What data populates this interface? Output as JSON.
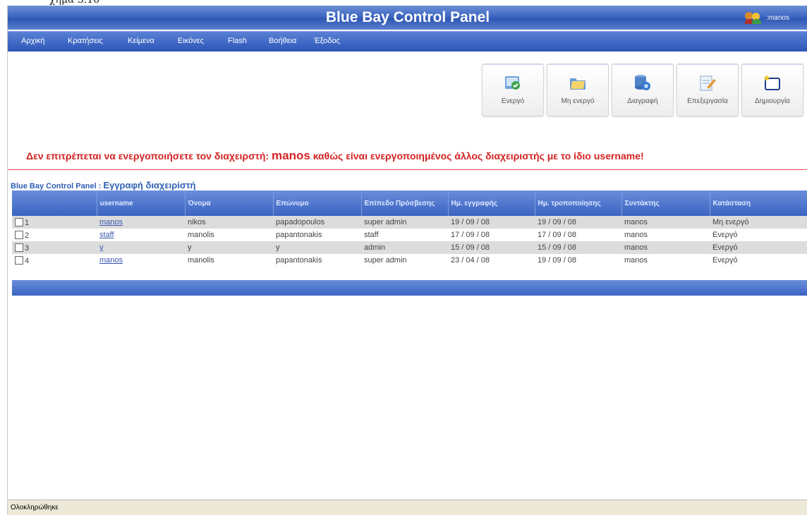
{
  "fragment_text": "χήμα 3.16",
  "header": {
    "title": "Blue Bay Control Panel",
    "user_label": ":manos"
  },
  "menu": [
    "Αρχική",
    "Κρατήσεις",
    "Κείμενα",
    "Εικόνες",
    "Flash",
    "Βοήθεια",
    "Έξοδος"
  ],
  "toolbar": [
    {
      "label": "Ενεργό",
      "icon": "active-icon"
    },
    {
      "label": "Μη ενεργό",
      "icon": "folder-icon"
    },
    {
      "label": "Διαγραφή",
      "icon": "database-delete-icon"
    },
    {
      "label": "Επεξεργασία",
      "icon": "edit-icon"
    },
    {
      "label": "Δημιουργία",
      "icon": "new-folder-icon"
    }
  ],
  "message": {
    "prefix": "Δεν επιτρέπεται να ενεργοποιήσετε τον διαχειρστή:",
    "username": "manos",
    "suffix": "καθώς είναι ενεργοποιημένος άλλος διαχειριστής με το ίδιο username!"
  },
  "breadcrumb": {
    "part1": "Blue Bay Control Panel : ",
    "part2": "Εγγραφή διαχειρίστή"
  },
  "table": {
    "headers": [
      "",
      "username",
      "Όνομα",
      "Επώνυμο",
      "Επίπεδο Πρόσβεσης",
      "Ημ. εγγραφής",
      "Ημ. τροποποίησης",
      "Συντάκτης",
      "Κατάσταση"
    ],
    "rows": [
      [
        "1",
        "manos",
        "nikos",
        "papadopoulos",
        "super admin",
        "19 / 09 / 08",
        "19 / 09 / 08",
        "manos",
        "Μη ενεργό"
      ],
      [
        "2",
        "staff",
        "manolis",
        "papantonakis",
        "staff",
        "17 / 09 / 08",
        "17 / 09 / 08",
        "manos",
        "Ενεργό"
      ],
      [
        "3",
        "y",
        "y",
        "y",
        "admin",
        "15 / 09 / 08",
        "15 / 09 / 08",
        "manos",
        "Ενεργό"
      ],
      [
        "4",
        "manos",
        "manolis",
        "papantonakis",
        "super admin",
        "23 / 04 / 08",
        "19 / 09 / 08",
        "manos",
        "Ενεργό"
      ]
    ]
  },
  "status_bar": "Ολοκληρώθηκε"
}
